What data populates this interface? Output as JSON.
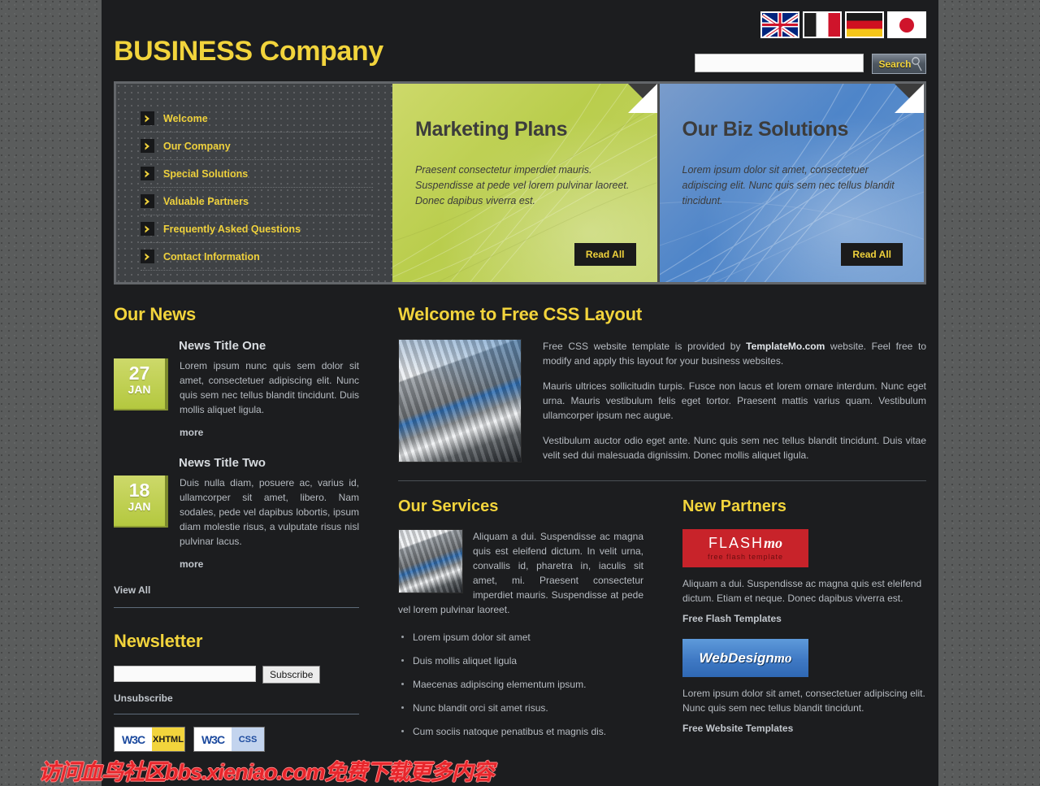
{
  "header": {
    "logo_prefix": "BUSINESS",
    "logo_suffix": " Company",
    "search_value": "",
    "search_placeholder": "",
    "search_button": "Search",
    "flags": [
      {
        "name": "flag-uk",
        "label": "English"
      },
      {
        "name": "flag-fr",
        "label": "French"
      },
      {
        "name": "flag-de",
        "label": "German"
      },
      {
        "name": "flag-jp",
        "label": "Japanese"
      }
    ]
  },
  "menu": {
    "items": [
      {
        "label": "Welcome"
      },
      {
        "label": "Our Company"
      },
      {
        "label": "Special Solutions"
      },
      {
        "label": "Valuable Partners"
      },
      {
        "label": "Frequently Asked Questions"
      },
      {
        "label": "Contact Information"
      }
    ]
  },
  "panels": [
    {
      "title": "Marketing Plans",
      "text": "Praesent consectetur imperdiet mauris. Suspendisse at pede vel lorem pulvinar laoreet. Donec dapibus viverra est.",
      "button": "Read All",
      "color": "#bccd4e"
    },
    {
      "title": "Our Biz Solutions",
      "text": "Lorem ipsum dolor sit amet, consectetuer adipiscing elit. Nunc quis sem nec tellus blandit tincidunt.",
      "button": "Read All",
      "color": "#4e85c9"
    }
  ],
  "news": {
    "heading": "Our News",
    "items": [
      {
        "title": "News Title One",
        "day": "27",
        "month": "JAN",
        "text": "Lorem ipsum nunc quis sem dolor sit amet, consectetuer adipiscing elit. Nunc quis sem nec tellus blandit tincidunt. Duis mollis aliquet ligula.",
        "more": "more"
      },
      {
        "title": "News Title Two",
        "day": "18",
        "month": "JAN",
        "text": "Duis nulla diam, posuere ac, varius id, ullamcorper sit amet, libero. Nam sodales, pede vel dapibus lobortis, ipsum diam molestie risus, a vulputate risus nisl pulvinar lacus.",
        "more": "more"
      }
    ],
    "view_all": "View All"
  },
  "newsletter": {
    "heading": "Newsletter",
    "input_value": "",
    "input_placeholder": "",
    "subscribe_button": "Subscribe",
    "unsubscribe_link": "Unsubscribe",
    "badges": [
      {
        "mark": "W3C",
        "label": "XHTML"
      },
      {
        "mark": "W3C",
        "label": "CSS"
      }
    ]
  },
  "welcome": {
    "heading": "Welcome to Free CSS Layout",
    "paragraphs": [
      {
        "pre": "Free CSS website template is provided by ",
        "bold": "TemplateMo.com",
        "post": " website. Feel free to modify and apply this layout for your business websites."
      },
      {
        "pre": "Mauris ultrices sollicitudin turpis. Fusce non lacus et lorem ornare interdum. Nunc eget urna. Mauris vestibulum felis eget tortor. Praesent mattis varius quam. Vestibulum ullamcorper ipsum nec augue.",
        "bold": "",
        "post": ""
      },
      {
        "pre": "Vestibulum auctor odio eget ante. Nunc quis sem nec tellus blandit tincidunt. Duis vitae velit sed dui malesuada dignissim. Donec mollis aliquet ligula.",
        "bold": "",
        "post": ""
      }
    ]
  },
  "services": {
    "heading": "Our Services",
    "paragraph": "Aliquam a dui. Suspendisse ac magna quis est eleifend dictum. In velit urna, convallis id, pharetra in, iaculis sit amet, mi. Praesent consectetur imperdiet mauris. Suspendisse at pede vel lorem pulvinar laoreet.",
    "list": [
      "Lorem ipsum dolor sit amet",
      "Duis mollis aliquet ligula",
      "Maecenas adipiscing elementum ipsum.",
      "Nunc blandit orci sit amet risus.",
      "Cum sociis natoque penatibus et magnis dis."
    ]
  },
  "partners": {
    "heading": "New Partners",
    "items": [
      {
        "logo_main": "FLASH",
        "logo_italic": "mo",
        "logo_sub": "free flash template",
        "text": "Aliquam a dui. Suspendisse ac magna quis est eleifend dictum. Etiam et neque. Donec dapibus viverra est.",
        "link": "Free Flash Templates"
      },
      {
        "logo_main": "WebDesign",
        "logo_italic": "mo",
        "logo_sub": "",
        "text": "Lorem ipsum dolor sit amet, consectetuer adipiscing elit. Nunc quis sem nec tellus blandit tincidunt.",
        "link": "Free Website Templates"
      }
    ]
  },
  "watermark": {
    "text": "访问血鸟社区bbs.xieniao.com免费下载更多内容"
  },
  "theme": {
    "accent_yellow": "#f2d43c",
    "page_bg": "#1c1d1f",
    "outer_bg": "#5a5c5c",
    "green": "#bccd4e",
    "blue": "#4e85c9",
    "red": "#c8232a"
  }
}
